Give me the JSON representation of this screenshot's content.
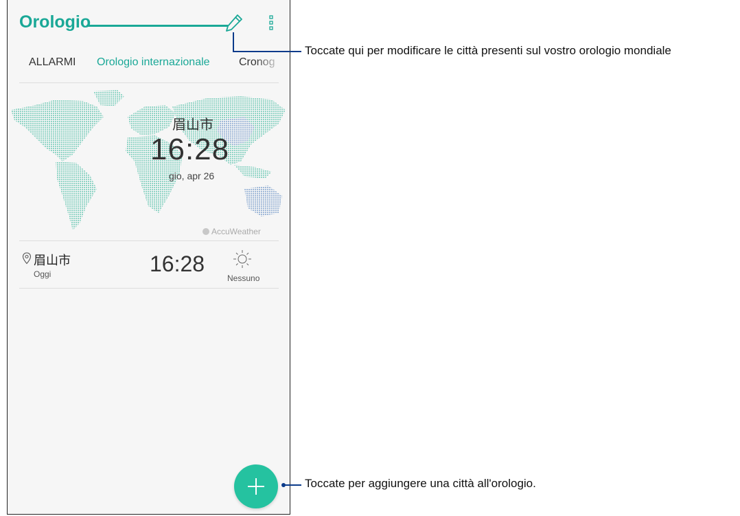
{
  "app": {
    "title": "Orologio"
  },
  "toolbar": {
    "edit_icon": "pencil-icon",
    "menu_icon": "more-vert-icon"
  },
  "tabs": [
    {
      "label": "ALLARMI"
    },
    {
      "label": "Orologio internazionale",
      "active": true
    },
    {
      "label": "Cronog"
    }
  ],
  "map": {
    "city": "眉山市",
    "time": "16:28",
    "date": "gio, apr 26",
    "provider": "AccuWeather"
  },
  "city_list": [
    {
      "city": "眉山市",
      "day": "Oggi",
      "time": "16:28",
      "weather": "Nessuno",
      "weather_icon": "sun-icon"
    }
  ],
  "fab": {
    "icon": "plus-icon"
  },
  "callouts": {
    "edit": "Toccate qui per modificare le città presenti sul vostro orologio mondiale",
    "add": "Toccate per aggiungere una città all'orologio."
  },
  "colors": {
    "accent": "#1aa897",
    "fab": "#25c2a0",
    "callout_line": "#0a3a8a"
  }
}
